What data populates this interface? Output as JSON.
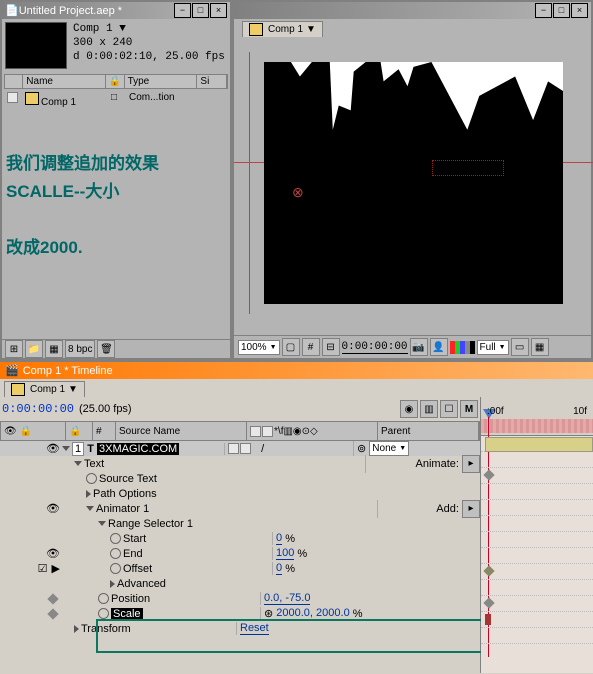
{
  "project": {
    "title": "Untitled Project.aep *",
    "comp_name": "Comp 1",
    "dims": "300 x 240",
    "duration": "d 0:00:02:10, 25.00 fps",
    "name_col": "Name",
    "type_col": "Type",
    "size_col": "Si",
    "items": [
      {
        "name": "Comp 1",
        "type": "Com...tion"
      }
    ],
    "bpc": "8 bpc"
  },
  "annotation": {
    "l1": "我们调整追加的效果",
    "l2": "SCALLE--大小",
    "l3": "改成2000."
  },
  "compview": {
    "tab": "Comp 1",
    "zoom": "100%",
    "time": "0:00:00:00",
    "res": "Full"
  },
  "timeline": {
    "title": "Comp 1 * Timeline",
    "tab": "Comp 1",
    "time": "0:00:00:00",
    "fps": "(25.00 fps)",
    "col_source": "Source Name",
    "col_parent": "Parent",
    "tick_00f": ":00f",
    "tick_10f": "10f",
    "parent_val": "None",
    "layer": {
      "num": "1",
      "name": "3XMAGIC.COM"
    },
    "btn_animate": "Animate:",
    "btn_add": "Add:",
    "props": {
      "text": "Text",
      "source_text": "Source Text",
      "path_options": "Path Options",
      "animator1": "Animator 1",
      "range_sel": "Range Selector 1",
      "start": "Start",
      "start_v": "0",
      "end": "End",
      "end_v": "100",
      "offset": "Offset",
      "offset_v": "0",
      "advanced": "Advanced",
      "position": "Position",
      "position_v": "0.0, -75.0",
      "scale": "Scale",
      "scale_v": "2000.0, 2000.0",
      "transform": "Transform",
      "reset": "Reset"
    },
    "pct": "%"
  }
}
